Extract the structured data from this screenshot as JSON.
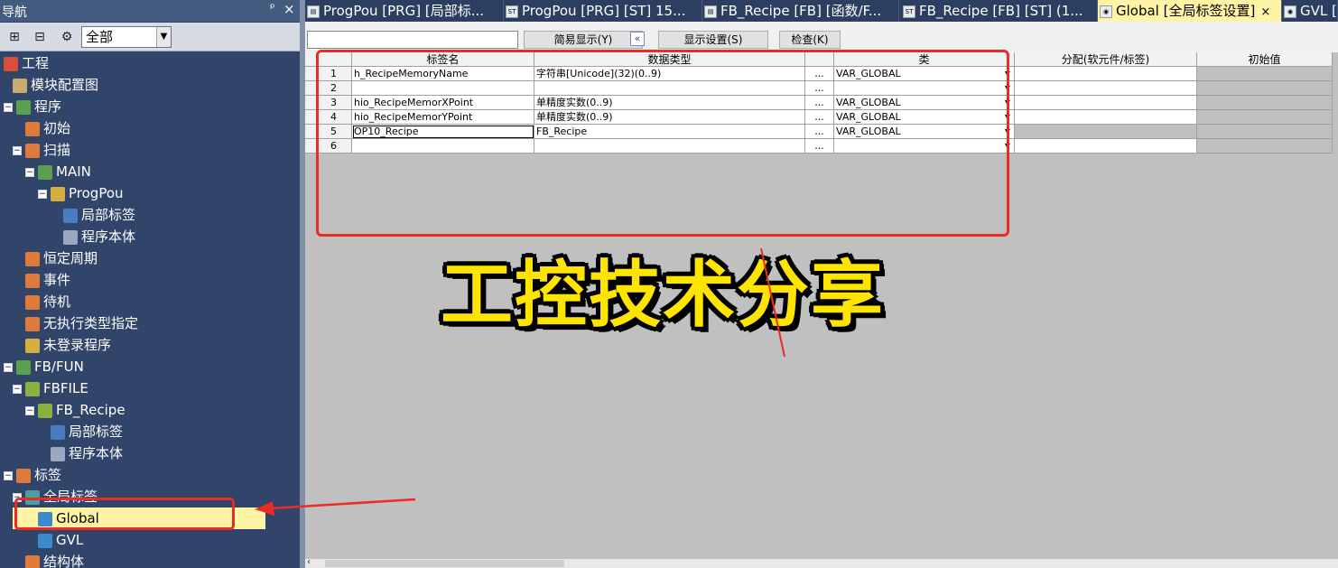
{
  "nav": {
    "title": "导航",
    "pin": "ᵖ",
    "close": "×",
    "filter_value": "全部",
    "tree": [
      {
        "label": "工程",
        "expander": "",
        "color": "#d94f3a"
      },
      {
        "label": "模块配置图",
        "expander": "",
        "color": "#c7ae6e"
      },
      {
        "label": "程序",
        "expander": "−",
        "color": "#5aa04e"
      },
      {
        "label": "初始",
        "expander": "",
        "color": "#e07a3a"
      },
      {
        "label": "扫描",
        "expander": "−",
        "color": "#e07a3a"
      },
      {
        "label": "MAIN",
        "expander": "−",
        "color": "#5aa04e"
      },
      {
        "label": "ProgPou",
        "expander": "−",
        "color": "#d4b040"
      },
      {
        "label": "局部标签",
        "expander": "",
        "color": "#4a7cc0"
      },
      {
        "label": "程序本体",
        "expander": "",
        "color": "#9aa8c0"
      },
      {
        "label": "恒定周期",
        "expander": "",
        "color": "#e07a3a"
      },
      {
        "label": "事件",
        "expander": "",
        "color": "#e07a3a"
      },
      {
        "label": "待机",
        "expander": "",
        "color": "#e07a3a"
      },
      {
        "label": "无执行类型指定",
        "expander": "",
        "color": "#e07a3a"
      },
      {
        "label": "未登录程序",
        "expander": "",
        "color": "#d4b040"
      },
      {
        "label": "FB/FUN",
        "expander": "−",
        "color": "#5aa04e"
      },
      {
        "label": "FBFILE",
        "expander": "−",
        "color": "#8cb040"
      },
      {
        "label": "FB_Recipe",
        "expander": "−",
        "color": "#8cb040"
      },
      {
        "label": "局部标签",
        "expander": "",
        "color": "#4a7cc0"
      },
      {
        "label": "程序本体",
        "expander": "",
        "color": "#9aa8c0"
      },
      {
        "label": "标签",
        "expander": "−",
        "color": "#e07a3a"
      },
      {
        "label": "全局标签",
        "expander": "−",
        "color": "#4aa0a0"
      },
      {
        "label": "Global",
        "expander": "",
        "color": "#3a8acc"
      },
      {
        "label": "GVL",
        "expander": "",
        "color": "#3a8acc"
      },
      {
        "label": "结构体",
        "expander": "",
        "color": "#e07a3a"
      }
    ]
  },
  "tabs": [
    {
      "label": "ProgPou [PRG] [局部标...",
      "icon": "▤",
      "active": false
    },
    {
      "label": "ProgPou [PRG] [ST] 15...",
      "icon": "ST",
      "active": false
    },
    {
      "label": "FB_Recipe [FB] [函数/F...",
      "icon": "▤",
      "active": false
    },
    {
      "label": "FB_Recipe [FB] [ST] (1...",
      "icon": "ST",
      "active": false
    },
    {
      "label": "Global [全局标签设置]",
      "icon": "◉",
      "active": true
    },
    {
      "label": "GVL [全",
      "icon": "◉",
      "active": false
    }
  ],
  "toolbar": {
    "simple_display": "简易显示(Y)",
    "collapse": "«",
    "display_settings": "显示设置(S)",
    "check": "检查(K)"
  },
  "grid": {
    "headers": [
      "标签名",
      "数据类型",
      "",
      "类",
      "分配(软元件/标签)",
      "初始值"
    ],
    "rows": [
      {
        "num": "1",
        "name": "h_RecipeMemoryName",
        "type": "字符串[Unicode](32)(0..9)",
        "class": "VAR_GLOBAL"
      },
      {
        "num": "2",
        "name": "",
        "type": "",
        "class": ""
      },
      {
        "num": "3",
        "name": "hio_RecipeMemorXPoint",
        "type": "单精度实数(0..9)",
        "class": "VAR_GLOBAL"
      },
      {
        "num": "4",
        "name": "hio_RecipeMemorYPoint",
        "type": "单精度实数(0..9)",
        "class": "VAR_GLOBAL"
      },
      {
        "num": "5",
        "name": "OP10_Recipe",
        "type": "FB_Recipe",
        "class": "VAR_GLOBAL"
      },
      {
        "num": "6",
        "name": "",
        "type": "",
        "class": ""
      }
    ],
    "dots": "..."
  },
  "watermark": "工控技术分享",
  "colors": {
    "annotation": "#ee2a24",
    "highlight": "#fff3a6",
    "watermark": "#ffe400"
  }
}
